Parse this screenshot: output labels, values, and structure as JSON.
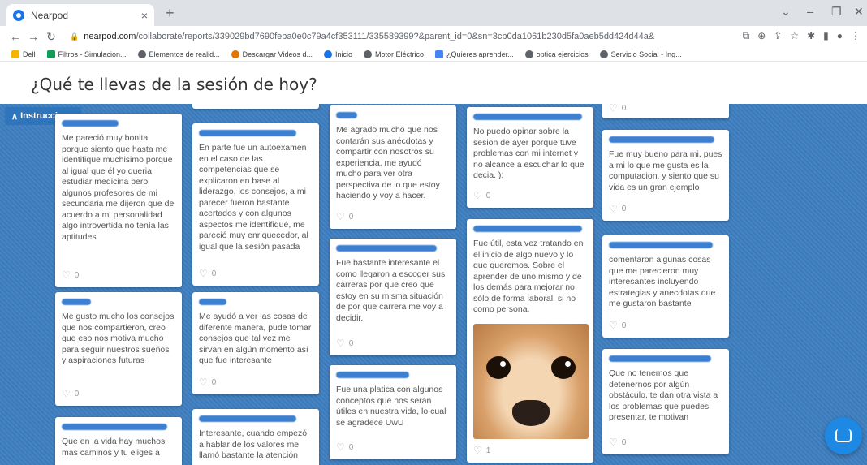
{
  "browser": {
    "tab_title": "Nearpod",
    "tab_close": "×",
    "new_tab": "+",
    "url_host": "nearpod.com",
    "url_rest": "/collaborate/reports/339029bd7690feba0e0c79a4cf353111/335589399?&parent_id=0&sn=3cb0da1061b230d5fa0aeb5dd424d44a&",
    "bookmarks": [
      "Dell",
      "Filtros - Simulacion...",
      "Elementos de realid...",
      "Descargar Videos d...",
      "Inicio",
      "Motor Eléctrico",
      "¿Quieres aprender...",
      "optica ejercicios",
      "Servicio Social - Ing..."
    ]
  },
  "page": {
    "title": "¿Qué te llevas de la sesión de hoy?",
    "instructions_label": "Instrucciones"
  },
  "cards": [
    {
      "text": "Me pareció muy bonita porque siento que hasta me identifique muchisimo porque al igual que él yo queria estudiar medicina pero algunos profesores de mi secundaria me dijeron que de acuerdo a mi personalidad algo introvertida no tenía las aptitudes",
      "likes": "0"
    },
    {
      "text": "Me gusto mucho los consejos que nos compartieron, creo que eso nos motiva mucho para seguir nuestros sueños y aspiraciones futuras",
      "likes": "0"
    },
    {
      "text": "Que en la vida hay muchos mas caminos y tu eliges a",
      "likes": ""
    },
    {
      "text": "En parte fue un autoexamen en el caso de las competencias que se explicaron en base al liderazgo, los consejos, a mi parecer fueron bastante acertados y con algunos aspectos me identifiqué, me pareció muy enriquecedor, al igual que la sesión pasada",
      "likes": "0"
    },
    {
      "text": "Me ayudó a ver las cosas de diferente manera, pude tomar consejos que tal vez me sirvan en algún momento así que fue interesante",
      "likes": "0"
    },
    {
      "text": "Interesante, cuando empezó a hablar de los valores me llamó bastante la atención",
      "likes": ""
    },
    {
      "text": "Me agrado mucho que nos contarán sus anécdotas y compartir con nosotros su experiencia, me ayudó mucho para ver otra perspectiva de lo que estoy haciendo y voy a hacer.",
      "likes": "0"
    },
    {
      "text": "Fue bastante interesante el como llegaron a escoger sus carreras por que creo que estoy en su misma situación de por que carrera me voy a decidir.",
      "likes": "0"
    },
    {
      "text": "Fue una platica con algunos conceptos que nos serán útiles en nuestra vida, lo cual se agradece UwU",
      "likes": "0"
    },
    {
      "text": "No puedo opinar sobre la sesion de ayer porque tuve problemas con mi internet y no alcance a escuchar lo que decia. ):",
      "likes": "0"
    },
    {
      "text": "Fue útil, esta vez tratando en el inicio de algo nuevo y lo que queremos. Sobre el aprender de uno mismo y de los demás para mejorar no sólo de forma laboral, si no como persona.",
      "likes": "1"
    },
    {
      "text": "",
      "likes": "0"
    },
    {
      "text": "Fue muy bueno para mi, pues a mi lo que me gusta es la computacion, y siento que su vida es un gran ejemplo",
      "likes": "0"
    },
    {
      "text": "comentaron algunas cosas que me parecieron muy interesantes incluyendo estrategias y anecdotas que me gustaron bastante",
      "likes": "0"
    },
    {
      "text": "Que no tenemos que detenernos por algún obstáculo, te dan otra vista a los problemas que puedes presentar, te motivan",
      "likes": "0"
    }
  ]
}
